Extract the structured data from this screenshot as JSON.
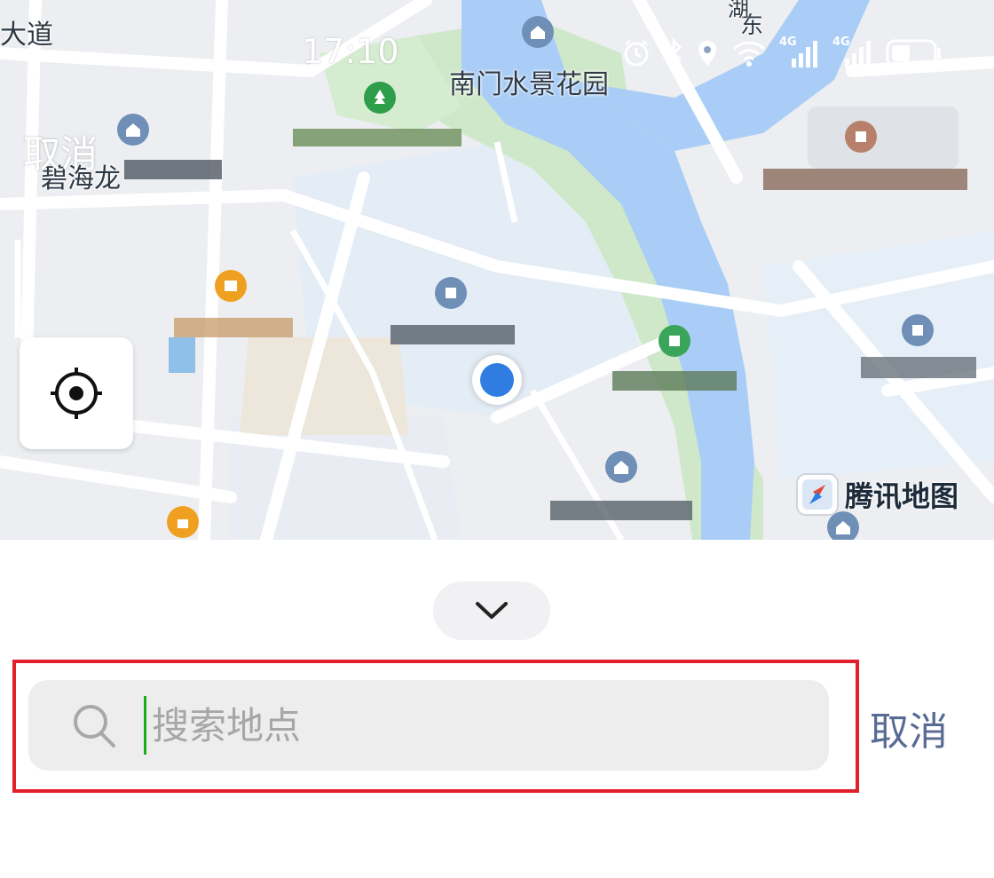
{
  "status_bar": {
    "time": "17:10",
    "network_1": "4G",
    "network_2": "4G"
  },
  "map": {
    "top_cancel_label": "取消",
    "brand": "腾讯地图",
    "labels": {
      "road_dadao": "大道",
      "nanmen_garden": "南门水景花园",
      "bihai": "碧海龙",
      "road_dong": "东",
      "road_hu": "湖"
    },
    "icons": {
      "locate": "locate-crosshair-icon",
      "compass": "compass-icon"
    }
  },
  "panel": {
    "search": {
      "placeholder": "搜索地点",
      "value": ""
    },
    "cancel_label": "取消",
    "colors": {
      "cancel": "#576b95",
      "highlight": "#e0202a",
      "caret": "#1aad19"
    }
  }
}
